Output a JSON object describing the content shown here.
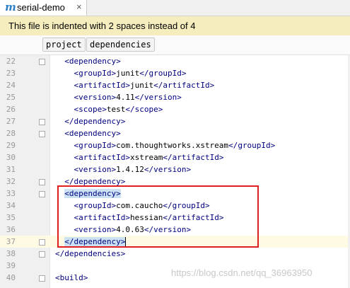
{
  "tab": {
    "icon": "m",
    "label": "serial-demo",
    "close": "×"
  },
  "banner": {
    "text": "This file is indented with 2 spaces instead of 4"
  },
  "breadcrumbs": [
    "project",
    "dependencies"
  ],
  "lines": [
    {
      "num": "22",
      "indent": "  ",
      "tag": "dependency",
      "kind": "open"
    },
    {
      "num": "23",
      "indent": "    ",
      "tag": "groupId",
      "kind": "full",
      "value": "junit"
    },
    {
      "num": "24",
      "indent": "    ",
      "tag": "artifactId",
      "kind": "full",
      "value": "junit"
    },
    {
      "num": "25",
      "indent": "    ",
      "tag": "version",
      "kind": "full",
      "value": "4.11"
    },
    {
      "num": "26",
      "indent": "    ",
      "tag": "scope",
      "kind": "full",
      "value": "test"
    },
    {
      "num": "27",
      "indent": "  ",
      "tag": "dependency",
      "kind": "close"
    },
    {
      "num": "28",
      "indent": "  ",
      "tag": "dependency",
      "kind": "open"
    },
    {
      "num": "29",
      "indent": "    ",
      "tag": "groupId",
      "kind": "full",
      "value": "com.thoughtworks.xstream"
    },
    {
      "num": "30",
      "indent": "    ",
      "tag": "artifactId",
      "kind": "full",
      "value": "xstream"
    },
    {
      "num": "31",
      "indent": "    ",
      "tag": "version",
      "kind": "full",
      "value": "1.4.12"
    },
    {
      "num": "32",
      "indent": "  ",
      "tag": "dependency",
      "kind": "close"
    },
    {
      "num": "33",
      "indent": "  ",
      "tag": "dependency",
      "kind": "open",
      "highlight": true
    },
    {
      "num": "34",
      "indent": "    ",
      "tag": "groupId",
      "kind": "full",
      "value": "com.caucho"
    },
    {
      "num": "35",
      "indent": "    ",
      "tag": "artifactId",
      "kind": "full",
      "value": "hessian"
    },
    {
      "num": "36",
      "indent": "    ",
      "tag": "version",
      "kind": "full",
      "value": "4.0.63"
    },
    {
      "num": "37",
      "indent": "  ",
      "tag": "dependency",
      "kind": "close",
      "highlight": true,
      "current": true
    },
    {
      "num": "38",
      "indent": "",
      "tag": "dependencies",
      "kind": "close"
    },
    {
      "num": "39",
      "indent": "",
      "tag": "",
      "kind": "blank"
    },
    {
      "num": "40",
      "indent": "",
      "tag": "build",
      "kind": "open"
    }
  ],
  "watermark": "https://blog.csdn.net/qq_36963950"
}
